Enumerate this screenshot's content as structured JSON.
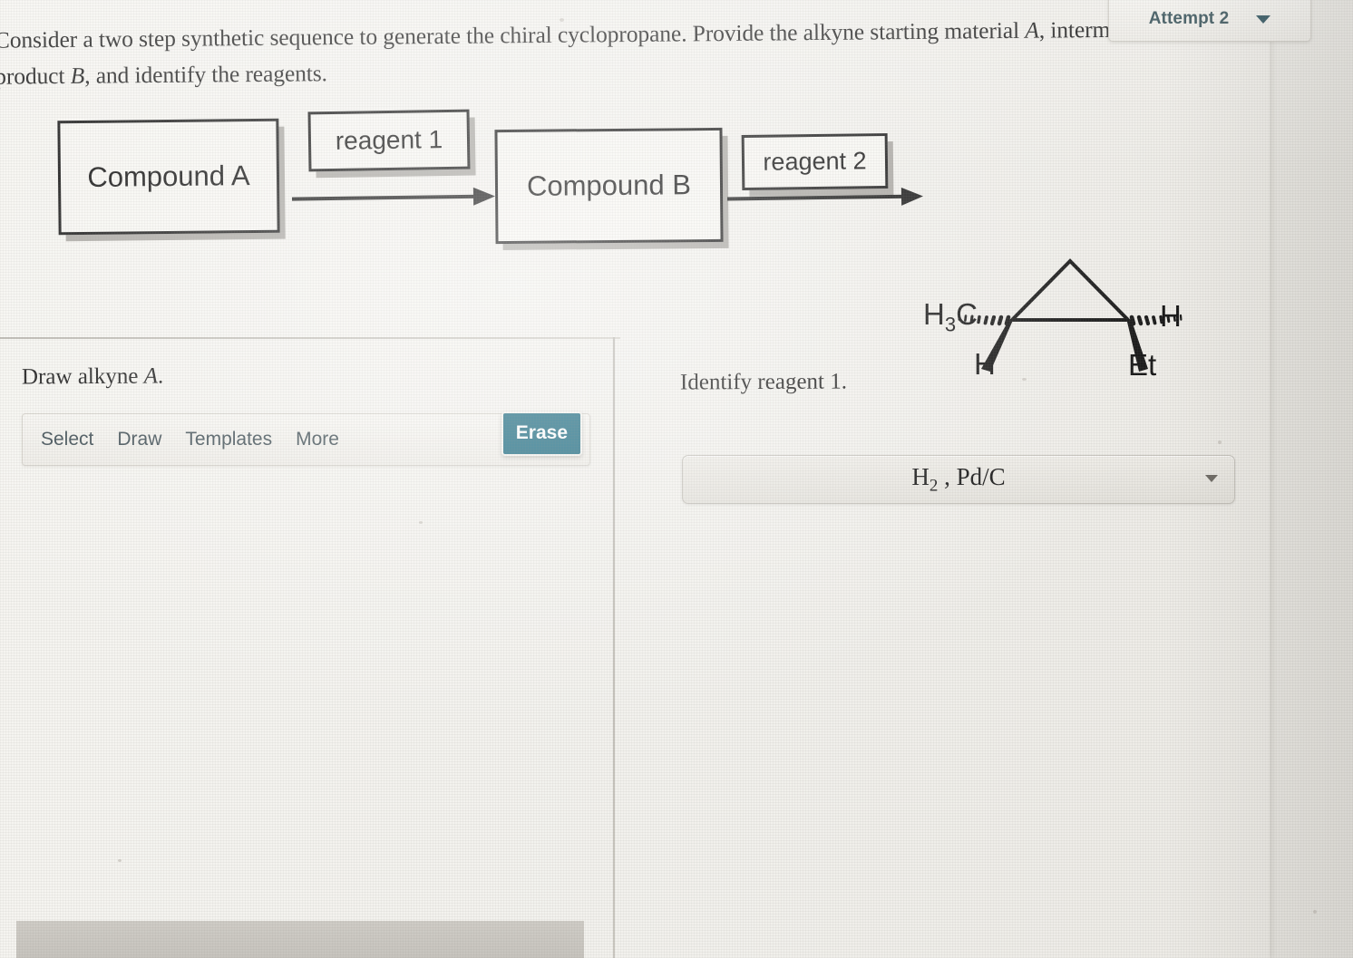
{
  "header": {
    "attempt_label": "Attempt 2",
    "caret_icon": "chevron-down-icon"
  },
  "question": {
    "line1_a": "Consider a two step synthetic sequence to generate the chiral cyclopropane. Provide the alkyne starting material ",
    "line1_italic": "A",
    "line1_b": ", intermediate organic product ",
    "line1_italic2": "B",
    "line1_c": ", and identify the reagents."
  },
  "scheme": {
    "compound_a": "Compound A",
    "compound_b": "Compound B",
    "reagent_1": "reagent 1",
    "reagent_2": "reagent 2",
    "product": {
      "name": "chiral cyclopropane",
      "label_methyl": "H",
      "label_methyl_sub": "3",
      "label_methyl_c": "C",
      "label_h_right": "H",
      "label_h_left": "H",
      "label_ethyl": "Et",
      "stereo": {
        "methyl": "hashed-wedge-left",
        "h_left": "bold-wedge-down-left",
        "h_right": "hashed-wedge-right",
        "ethyl": "bold-wedge-down-right"
      }
    }
  },
  "left_panel": {
    "title_prefix": "Draw alkyne ",
    "title_italic": "A",
    "title_suffix": ".",
    "toolbar": {
      "items": [
        "Select",
        "Draw",
        "Templates",
        "More"
      ],
      "erase_label": "Erase"
    },
    "controls": {
      "undo_icon": "undo-icon",
      "redo_icon": "redo-icon",
      "zoom_in_icon": "zoom-in-icon",
      "zoom_reset_icon": "zoom-reset-icon",
      "zoom_out_icon": "zoom-out-icon",
      "undo_enabled": true,
      "redo_enabled": false
    }
  },
  "right_panel": {
    "title": "Identify reagent 1.",
    "select": {
      "value_a": "H",
      "value_sub": "2",
      "value_b": " , Pd/C",
      "caret_icon": "chevron-down-icon"
    }
  },
  "colors": {
    "accent_teal": "#1c6a80",
    "icon_teal": "#1f4c5c",
    "page_bg": "#f2f1ed",
    "line": "#141414"
  }
}
